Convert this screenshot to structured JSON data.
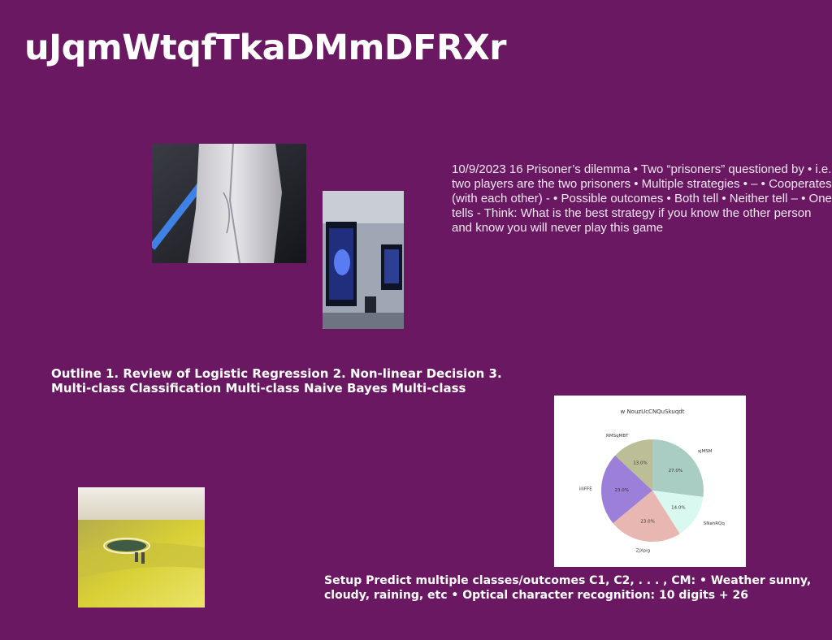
{
  "slide": {
    "title": "uJqmWtqfTkaDMmDFRXr",
    "body_text": "10/9/2023 16 Prisoner’s dilemma • Two “prisoners” questioned by • i.e. two players are the two prisoners • Multiple strategies • – • Cooperates (with each other) - • Possible outcomes • Both tell • Neither tell – • One tells - Think: What is the best strategy if you know the other person and know you will never play this game",
    "outline_text": "Outline 1. Review of Logistic Regression 2. Non-linear Decision 3. Multi-class Classification Multi-class Naive Bayes Multi-class",
    "setup_text": "Setup Predict multiple classes/outcomes C1, C2, . . . , CM: • Weather sunny, cloudy, raining, etc • Optical character recognition: 10 digits + 26",
    "colors": {
      "background": "#6b1862",
      "text": "#ffffff"
    }
  },
  "chart_data": {
    "type": "pie",
    "title": "w NouzUcCNQuSkuqdt",
    "labels": [
      "xjMSM",
      "SNahRQq",
      "ZjXpig",
      "iiliFFE",
      "RMSqMBT"
    ],
    "values": [
      27.0,
      14.0,
      23.0,
      23.0,
      13.0
    ],
    "value_labels": [
      "27.0%",
      "14.0%",
      "23.0%",
      "23.0%",
      "13.0%"
    ],
    "colors": [
      "#a9ccc3",
      "#d9f8ef",
      "#e9b7b2",
      "#9b7fd8",
      "#bcbe97"
    ],
    "start_angle_deg": 90,
    "direction": "clockwise"
  }
}
